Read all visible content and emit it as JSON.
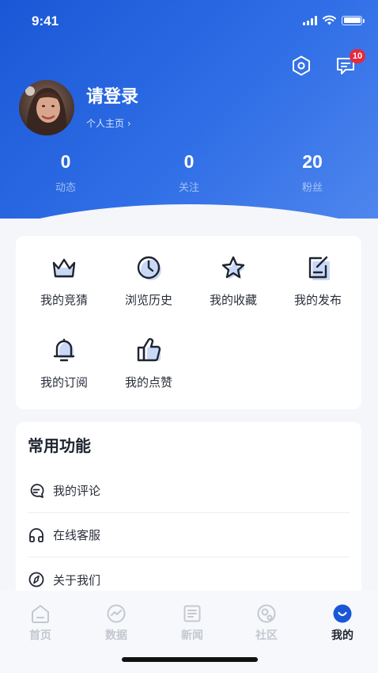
{
  "status_bar": {
    "time": "9:41"
  },
  "header": {
    "message_badge": "10",
    "username": "请登录",
    "profile_link": "个人主页 ›"
  },
  "stats": [
    {
      "value": "0",
      "label": "动态"
    },
    {
      "value": "0",
      "label": "关注"
    },
    {
      "value": "20",
      "label": "粉丝"
    }
  ],
  "quick_actions": [
    {
      "label": "我的竞猜",
      "icon": "crown-icon"
    },
    {
      "label": "浏览历史",
      "icon": "clock-icon"
    },
    {
      "label": "我的收藏",
      "icon": "star-icon"
    },
    {
      "label": "我的发布",
      "icon": "edit-icon"
    },
    {
      "label": "我的订阅",
      "icon": "bell-icon"
    },
    {
      "label": "我的点赞",
      "icon": "thumbs-up-icon"
    }
  ],
  "common_functions": {
    "title": "常用功能",
    "items": [
      {
        "label": "我的评论",
        "icon": "comment-icon"
      },
      {
        "label": "在线客服",
        "icon": "headset-icon"
      },
      {
        "label": "关于我们",
        "icon": "compass-icon"
      }
    ]
  },
  "tabbar": {
    "tabs": [
      {
        "label": "首页",
        "icon": "home-icon"
      },
      {
        "label": "数据",
        "icon": "chart-icon"
      },
      {
        "label": "新闻",
        "icon": "news-icon"
      },
      {
        "label": "社区",
        "icon": "community-icon"
      },
      {
        "label": "我的",
        "icon": "profile-icon"
      }
    ],
    "active": "我的"
  },
  "colors": {
    "brand": "#1a57d6",
    "badge": "#e8283a",
    "icon_accent": "#c9d8f6"
  }
}
